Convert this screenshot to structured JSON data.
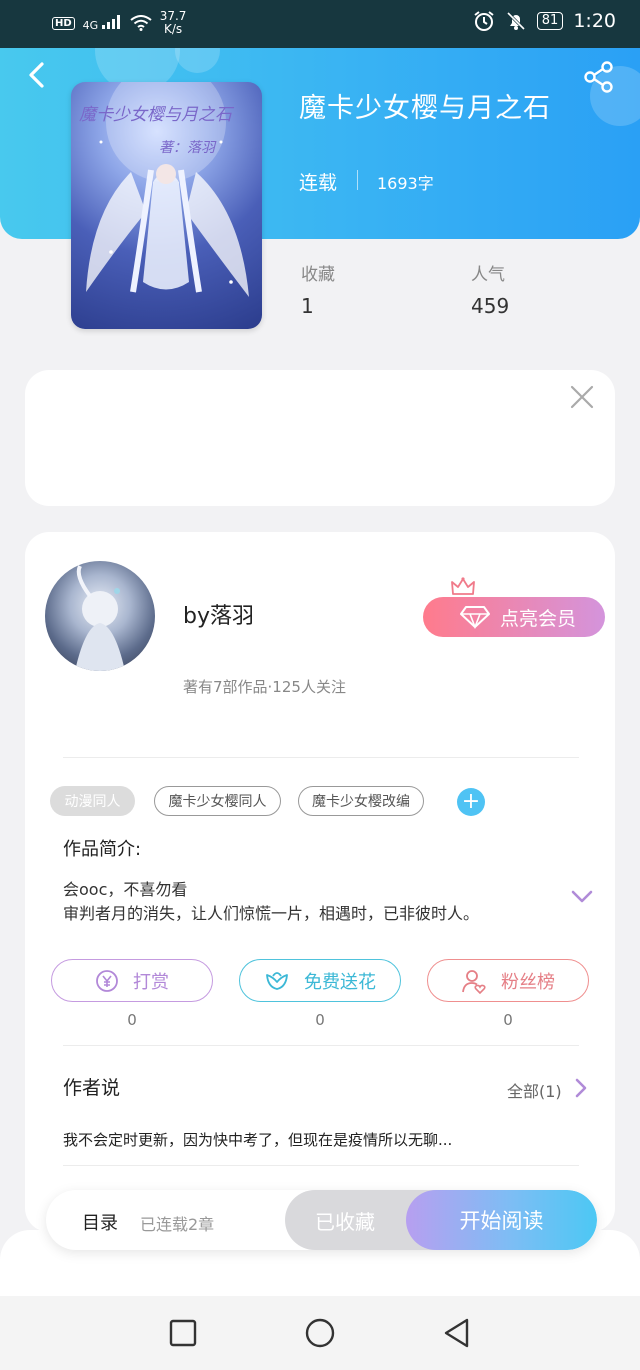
{
  "status_bar": {
    "hd": "HD",
    "signal": "4G",
    "speed_value": "37.7",
    "speed_unit": "K/s",
    "battery": "81",
    "time": "1:20"
  },
  "book": {
    "title": "魔卡少女樱与月之石",
    "status": "连载",
    "word_count": "1693字",
    "cover_text": "魔卡少女樱与月之石",
    "cover_author": "著：落羽",
    "stats": [
      {
        "label": "收藏",
        "value": "1"
      },
      {
        "label": "人气",
        "value": "459"
      }
    ]
  },
  "author": {
    "name": "by落羽",
    "meta": "著有7部作品·125人关注",
    "vip_button": "点亮会员"
  },
  "tags": [
    "动漫同人",
    "魔卡少女樱同人",
    "魔卡少女樱改编"
  ],
  "intro": {
    "heading": "作品简介:",
    "line1": "会ooc，不喜勿看",
    "line2": "审判者月的消失，让人们惊慌一片，相遇时，已非彼时人。"
  },
  "actions": [
    {
      "label": "打赏",
      "count": "0",
      "color": "#c59be0"
    },
    {
      "label": "免费送花",
      "count": "0",
      "color": "#4fc3dc"
    },
    {
      "label": "粉丝榜",
      "count": "0",
      "color": "#ef8f8f"
    }
  ],
  "author_says": {
    "heading": "作者说",
    "all_label": "全部(1)",
    "text": "我不会定时更新，因为快中考了，但现在是疫情所以无聊..."
  },
  "bottom_bar": {
    "toc": "目录",
    "toc_sub": "已连载2章",
    "collected": "已收藏",
    "read": "开始阅读"
  },
  "icons": {
    "back": "chevron-left-icon",
    "share": "share-icon",
    "close": "close-icon",
    "crown": "crown-icon",
    "diamond": "diamond-icon",
    "add": "plus-icon",
    "expand": "chevron-down-icon",
    "reward": "yen-icon",
    "flower": "flower-icon",
    "fans": "person-heart-icon",
    "more": "chevron-right-icon"
  }
}
